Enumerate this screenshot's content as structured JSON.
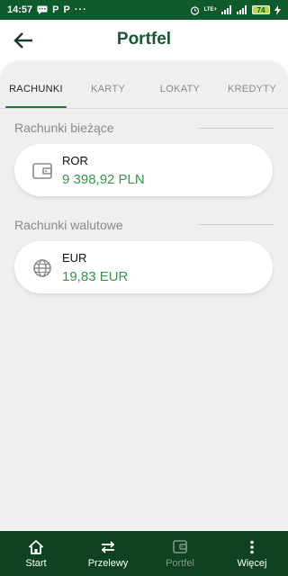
{
  "status_bar": {
    "time": "14:57",
    "app_badge_1": "P",
    "app_badge_2": "P",
    "more": "···",
    "lte": "LTE+",
    "battery": "74"
  },
  "header": {
    "title": "Portfel"
  },
  "tabs": [
    {
      "label": "RACHUNKI",
      "active": true
    },
    {
      "label": "KARTY",
      "active": false
    },
    {
      "label": "LOKATY",
      "active": false
    },
    {
      "label": "KREDYTY",
      "active": false
    }
  ],
  "sections": [
    {
      "title": "Rachunki bieżące",
      "accounts": [
        {
          "name": "ROR",
          "amount": "9 398,92 PLN",
          "icon": "wallet-icon"
        }
      ]
    },
    {
      "title": "Rachunki walutowe",
      "accounts": [
        {
          "name": "EUR",
          "amount": "19,83 EUR",
          "icon": "globe-icon"
        }
      ]
    }
  ],
  "bottom_nav": [
    {
      "label": "Start",
      "icon": "home-icon",
      "current": false
    },
    {
      "label": "Przelewy",
      "icon": "transfer-icon",
      "current": false
    },
    {
      "label": "Portfel",
      "icon": "wallet-icon",
      "current": true
    },
    {
      "label": "Więcej",
      "icon": "more-vertical-icon",
      "current": false
    }
  ],
  "colors": {
    "status_bar": "#0f5a2b",
    "title": "#145a2e",
    "amount": "#2e9a4a",
    "bottom_nav": "#0f4220"
  }
}
